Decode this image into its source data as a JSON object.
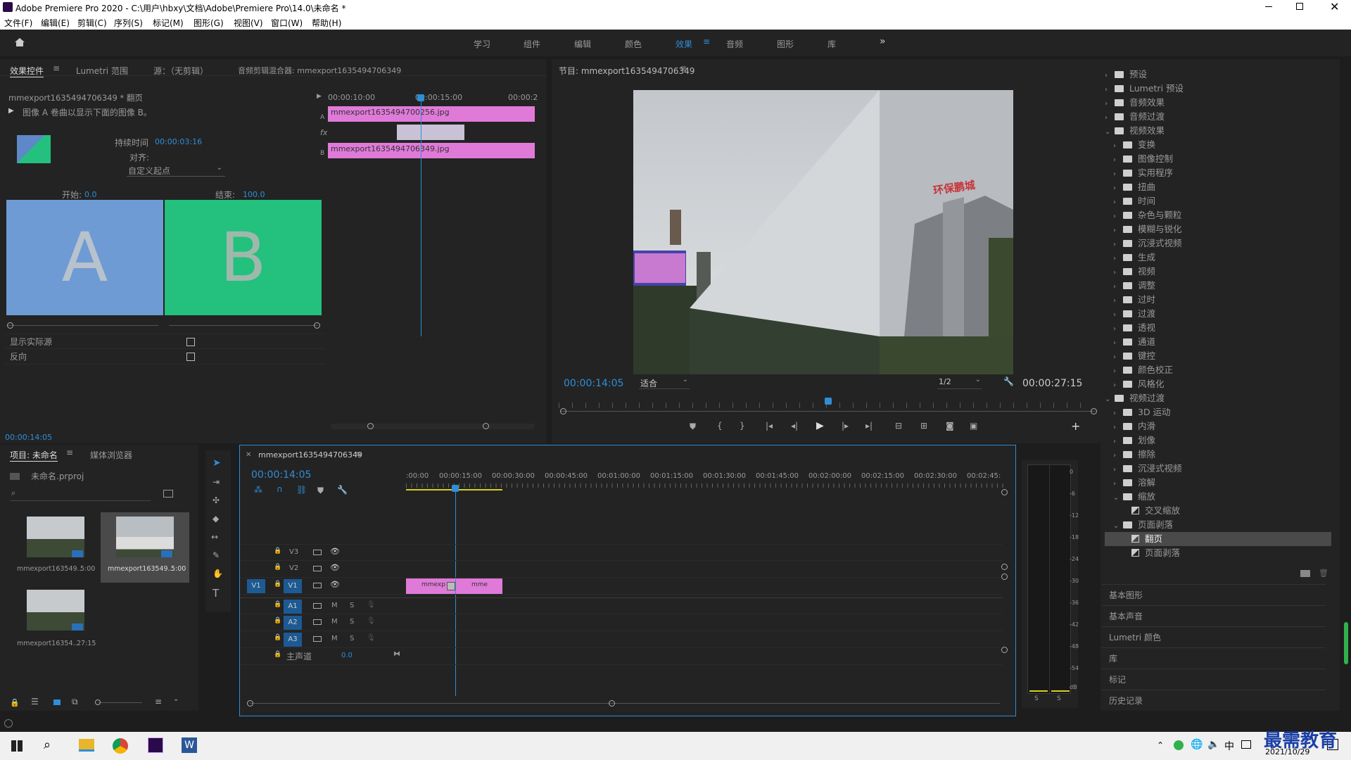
{
  "app": {
    "title": "Adobe Premiere Pro 2020 - C:\\用户\\hbxy\\文档\\Adobe\\Premiere Pro\\14.0\\未命名 *",
    "menu": [
      "文件(F)",
      "编辑(E)",
      "剪辑(C)",
      "序列(S)",
      "标记(M)",
      "图形(G)",
      "视图(V)",
      "窗口(W)",
      "帮助(H)"
    ]
  },
  "workspaces": [
    "学习",
    "组件",
    "编辑",
    "颜色",
    "效果",
    "音频",
    "图形",
    "库"
  ],
  "active_workspace": "效果",
  "effect_controls": {
    "tabs": [
      "效果控件",
      "Lumetri 范围",
      "源：（无剪辑）",
      "音频剪辑混合器: mmexport1635494706349"
    ],
    "clip_label": "mmexport1635494706349 * 翻页",
    "description": "图像 A 卷曲以显示下面的图像 B。",
    "duration_label": "持续时间",
    "duration_value": "00:00:03:16",
    "align_label": "对齐:",
    "align_value": "自定义起点",
    "start_label": "开始:",
    "start_value": "0.0",
    "end_label": "结束:",
    "end_value": "100.0",
    "a_letter": "A",
    "b_letter": "B",
    "show_actual_label": "显示实际源",
    "reverse_label": "反向",
    "mini_ruler": [
      "00:00:10:00",
      "00:00:15:00",
      "00:00:2"
    ],
    "track_a_label": "A",
    "track_b_label": "B",
    "fx_label": "fx",
    "clip_a": "mmexport1635494700256.jpg",
    "clip_b": "mmexport1635494706349.jpg",
    "timecode": "00:00:14:05"
  },
  "program": {
    "title": "节目: mmexport1635494706349",
    "timecode": "00:00:14:05",
    "fit": "适合",
    "resolution": "1/2",
    "duration": "00:00:27:15",
    "banner_text": "环保鹏城"
  },
  "project": {
    "tabs": [
      "项目: 未命名",
      "媒体浏览器"
    ],
    "file": "未命名.prproj",
    "items": [
      {
        "name": "mmexport163549...",
        "dur": "5:00"
      },
      {
        "name": "mmexport163549...",
        "dur": "5:00"
      },
      {
        "name": "mmexport16354...",
        "dur": "27:15"
      }
    ]
  },
  "timeline": {
    "seq_name": "mmexport1635494706349",
    "timecode": "00:00:14:05",
    "ruler": [
      ":00:00",
      "00:00:15:00",
      "00:00:30:00",
      "00:00:45:00",
      "00:01:00:00",
      "00:01:15:00",
      "00:01:30:00",
      "00:01:45:00",
      "00:02:00:00",
      "00:02:15:00",
      "00:02:30:00",
      "00:02:45:"
    ],
    "video_tracks": [
      "V3",
      "V2",
      "V1"
    ],
    "audio_tracks": [
      "A1",
      "A2",
      "A3"
    ],
    "master_label": "主声道",
    "master_value": "0.0",
    "clip1": "mmexp",
    "clip2": "mme",
    "source_v1": "V1",
    "m": "M",
    "s": "S"
  },
  "meters": {
    "scale": [
      "0",
      "-6",
      "-12",
      "-18",
      "-24",
      "-30",
      "-36",
      "-42",
      "-48",
      "-54",
      "dB"
    ],
    "solo": [
      "S",
      "S"
    ]
  },
  "effects_panel": {
    "tree": [
      {
        "label": "预设",
        "level": 0,
        "open": false
      },
      {
        "label": "Lumetri 预设",
        "level": 0,
        "open": false
      },
      {
        "label": "音频效果",
        "level": 0,
        "open": false
      },
      {
        "label": "音频过渡",
        "level": 0,
        "open": false
      },
      {
        "label": "视频效果",
        "level": 0,
        "open": true
      },
      {
        "label": "变换",
        "level": 1
      },
      {
        "label": "图像控制",
        "level": 1
      },
      {
        "label": "实用程序",
        "level": 1
      },
      {
        "label": "扭曲",
        "level": 1
      },
      {
        "label": "时间",
        "level": 1
      },
      {
        "label": "杂色与颗粒",
        "level": 1
      },
      {
        "label": "模糊与锐化",
        "level": 1
      },
      {
        "label": "沉浸式视频",
        "level": 1
      },
      {
        "label": "生成",
        "level": 1
      },
      {
        "label": "视频",
        "level": 1
      },
      {
        "label": "调整",
        "level": 1
      },
      {
        "label": "过时",
        "level": 1
      },
      {
        "label": "过渡",
        "level": 1
      },
      {
        "label": "透视",
        "level": 1
      },
      {
        "label": "通道",
        "level": 1
      },
      {
        "label": "键控",
        "level": 1
      },
      {
        "label": "颜色校正",
        "level": 1
      },
      {
        "label": "风格化",
        "level": 1
      },
      {
        "label": "视频过渡",
        "level": 0,
        "open": true
      },
      {
        "label": "3D 运动",
        "level": 1
      },
      {
        "label": "内滑",
        "level": 1
      },
      {
        "label": "划像",
        "level": 1
      },
      {
        "label": "擦除",
        "level": 1
      },
      {
        "label": "沉浸式视频",
        "level": 1
      },
      {
        "label": "溶解",
        "level": 1
      },
      {
        "label": "缩放",
        "level": 1,
        "open": true
      },
      {
        "label": "交叉缩放",
        "level": 2,
        "fx": true
      },
      {
        "label": "页面剥落",
        "level": 1,
        "open": true
      },
      {
        "label": "翻页",
        "level": 2,
        "fx": true,
        "selected": true
      },
      {
        "label": "页面剥落",
        "level": 2,
        "fx": true
      }
    ],
    "sections": [
      "基本图形",
      "基本声音",
      "Lumetri 颜色",
      "库",
      "标记",
      "历史记录"
    ]
  },
  "taskbar": {
    "time": "2021/10/29",
    "ime": "中",
    "watermark": "最需教育"
  },
  "colors": {
    "accent": "#2f8ed8",
    "clip": "#e07ad9",
    "a": "#6f9bd4",
    "b": "#23c07e"
  }
}
